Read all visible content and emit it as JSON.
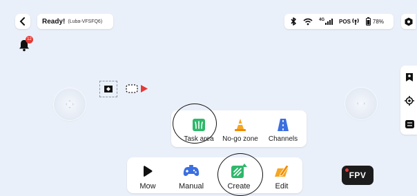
{
  "header": {
    "status_title": "Ready!",
    "device_name": "(Luba-VFSFQ6)",
    "network_label": "4G",
    "pos_label": "POS",
    "battery": "78%"
  },
  "notifications": {
    "badge_count": "12"
  },
  "popup_menu": {
    "items": [
      {
        "label": "Task area",
        "icon": "grass-icon"
      },
      {
        "label": "No-go zone",
        "icon": "traffic-cone-icon"
      },
      {
        "label": "Channels",
        "icon": "road-icon"
      }
    ]
  },
  "bottom_bar": {
    "items": [
      {
        "label": "Mow",
        "icon": "play-icon"
      },
      {
        "label": "Manual",
        "icon": "gamepad-icon"
      },
      {
        "label": "Create",
        "icon": "grass-create-icon"
      },
      {
        "label": "Edit",
        "icon": "edit-icon"
      }
    ]
  },
  "fpv": {
    "label": "FPV"
  },
  "colors": {
    "background": "#eaf0f9",
    "accent_green": "#2fb86b",
    "accent_orange": "#f5a623",
    "accent_blue": "#3b6fe0",
    "alert_red": "#e53935"
  }
}
